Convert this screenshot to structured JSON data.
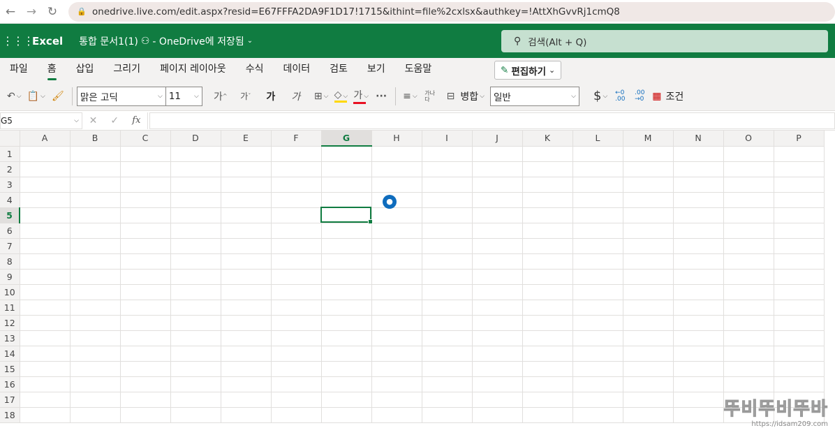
{
  "browser": {
    "url": "onedrive.live.com/edit.aspx?resid=E67FFFA2DA9F1D17!1715&ithint=file%2cxlsx&authkey=!AttXhGvvRj1cmQ8"
  },
  "header": {
    "app_name": "Excel",
    "doc_title": "통합 문서1(1)",
    "save_status": "- OneDrive에 저장됨",
    "search_placeholder": "검색(Alt + Q)"
  },
  "tabs": [
    "파일",
    "홈",
    "삽입",
    "그리기",
    "페이지 레이아웃",
    "수식",
    "데이터",
    "검토",
    "보기",
    "도움말"
  ],
  "active_tab": "홈",
  "edit_button": "편집하기",
  "toolbar": {
    "font_name": "맑은 고딕",
    "font_size": "11",
    "grow_font": "가",
    "shrink_font": "가",
    "bold": "가",
    "italic": "가",
    "font_color_glyph": "가",
    "more": "···",
    "wrap_text": "가나\n다",
    "merge_label": "병합",
    "number_format": "일반",
    "currency": "$",
    "cond_format_label": "조건",
    "highlight_color": "#ffd800",
    "font_color": "#e81123"
  },
  "formula_bar": {
    "name_box": "G5",
    "fx": "fx",
    "formula": ""
  },
  "grid": {
    "columns": [
      "A",
      "B",
      "C",
      "D",
      "E",
      "F",
      "G",
      "H",
      "I",
      "J",
      "K",
      "L",
      "M",
      "N",
      "O",
      "P"
    ],
    "rows": [
      "1",
      "2",
      "3",
      "4",
      "5",
      "6",
      "7",
      "8",
      "9",
      "10",
      "11",
      "12",
      "13",
      "14",
      "15",
      "16",
      "17",
      "18"
    ],
    "selected_col": "G",
    "selected_row": "5"
  },
  "watermark": {
    "text": "뚜비뚜비뚜바",
    "url": "https://idsam209.com"
  },
  "colors": {
    "brand": "#107c41",
    "search_bg": "#c6e0d0",
    "ribbon_bg": "#f3f2f1"
  }
}
